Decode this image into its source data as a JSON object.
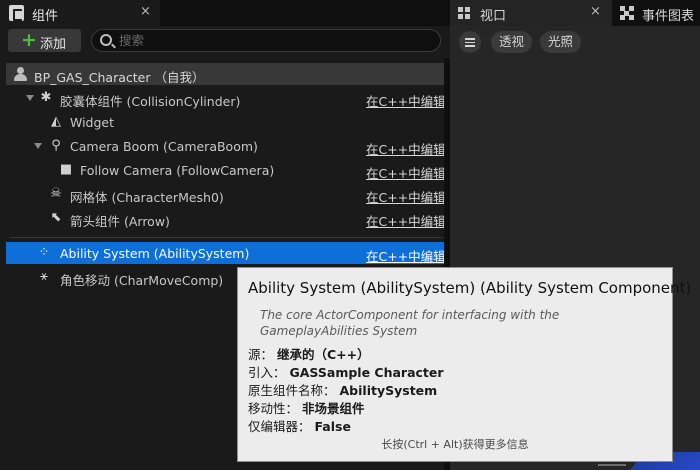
{
  "components_panel": {
    "tab_title": "组件",
    "tab_close": "×",
    "add_button": "添加",
    "search_placeholder": "搜索",
    "root": {
      "label": "BP_GAS_Character （自我）"
    },
    "edit_label": "在C++中编辑",
    "items": [
      {
        "name": "胶囊体组件 (CollisionCylinder)",
        "icon": "capsule-icon",
        "expandable": true,
        "editable": true,
        "selected": false
      },
      {
        "name": "Widget",
        "icon": "widget-icon",
        "expandable": false,
        "editable": false,
        "selected": false
      },
      {
        "name": "Camera Boom (CameraBoom)",
        "icon": "camera-boom-icon",
        "expandable": true,
        "editable": true,
        "selected": false
      },
      {
        "name": "Follow Camera (FollowCamera)",
        "icon": "camera-icon",
        "expandable": false,
        "editable": true,
        "selected": false
      },
      {
        "name": "网格体 (CharacterMesh0)",
        "icon": "skeleton-icon",
        "expandable": false,
        "editable": true,
        "selected": false
      },
      {
        "name": "箭头组件 (Arrow)",
        "icon": "arrow-icon",
        "expandable": false,
        "editable": true,
        "selected": false
      },
      {
        "name": "Ability System (AbilitySystem)",
        "icon": "ability-system-icon",
        "expandable": false,
        "editable": true,
        "selected": true
      },
      {
        "name": "角色移动 (CharMoveComp)",
        "icon": "character-movement-icon",
        "expandable": false,
        "editable": false,
        "selected": false
      }
    ]
  },
  "viewport_panel": {
    "tab_title": "视口",
    "tab_close": "×",
    "event_graph_tab": "事件图表",
    "buttons": {
      "perspective": "透视",
      "lighting": "光照"
    }
  },
  "tooltip": {
    "title": "Ability System (AbilitySystem) (Ability System Component)",
    "description": "The core ActorComponent for interfacing with the GameplayAbilities System",
    "fields": [
      {
        "label": "源：",
        "value": "继承的（C++）"
      },
      {
        "label": "引入：",
        "value": "GASSample Character"
      },
      {
        "label": "原生组件名称：",
        "value": "AbilitySystem"
      },
      {
        "label": "移动性：",
        "value": "非场景组件"
      },
      {
        "label": "仅编辑器：",
        "value": "False"
      }
    ],
    "hint": "长按(Ctrl + Alt)获得更多信息"
  },
  "colors": {
    "selection": "#0e6fd8",
    "add_plus": "#4bbf3a",
    "tooltip_bg": "#ececec"
  }
}
